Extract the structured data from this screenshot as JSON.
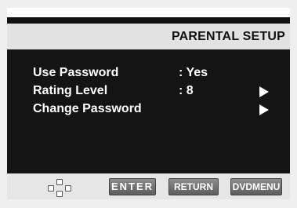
{
  "screen": {
    "title": "PARENTAL SETUP"
  },
  "menu": {
    "items": [
      {
        "label": "Use Password",
        "value": ": Yes",
        "has_arrow": false
      },
      {
        "label": "Rating Level",
        "value": ": 8",
        "has_arrow": true
      },
      {
        "label": "Change Password",
        "value": "",
        "has_arrow": true
      }
    ]
  },
  "footer": {
    "nav_icon": "dpad-icon",
    "enter_label": "ENTER",
    "return_label": "RETURN",
    "dvdmenu_label": "DVDMENU"
  },
  "colors": {
    "menu_background": "#141414",
    "title_bar": "#e2e2e2",
    "text": "#ffffff"
  }
}
